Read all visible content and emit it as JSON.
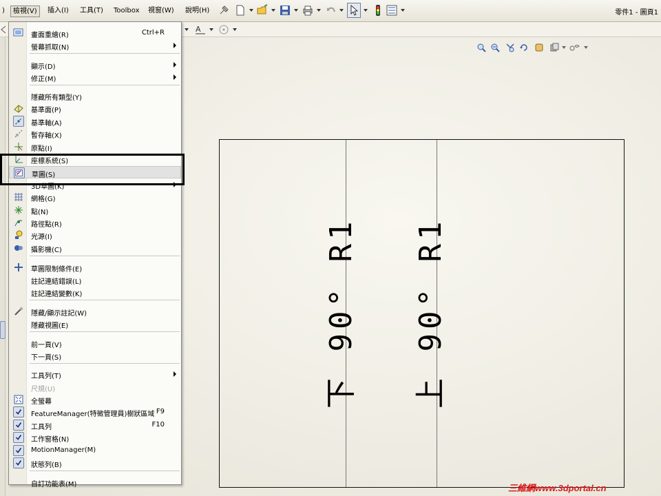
{
  "colors": {
    "accent": "#3b5fa8",
    "watermark": "#d81c1c"
  },
  "menubar": {
    "items": [
      {
        "label": ")"
      },
      {
        "label": "檢視(V)",
        "active": true
      },
      {
        "label": "插入(I)"
      },
      {
        "label": "工具(T)"
      },
      {
        "label": "Toolbox"
      },
      {
        "label": "視窗(W)"
      },
      {
        "label": "說明(H)"
      }
    ],
    "doc_title": "零件1 - 圖頁1"
  },
  "view_menu": {
    "items": [
      {
        "label": "畫面重繪(R)",
        "shortcut": "Ctrl+R",
        "icon": "redraw-icon"
      },
      {
        "label": "螢幕抓取(N)",
        "submenu": true
      },
      {
        "separator": true
      },
      {
        "label": "顯示(D)",
        "submenu": true
      },
      {
        "label": "修正(M)",
        "submenu": true
      },
      {
        "separator": true
      },
      {
        "label": "隱藏所有類型(Y)"
      },
      {
        "label": "基準面(P)",
        "icon": "plane-icon"
      },
      {
        "label": "基準軸(A)",
        "icon": "axis-icon",
        "checked": true
      },
      {
        "label": "暫存軸(X)",
        "icon": "temp-axis-icon"
      },
      {
        "label": "原點(I)",
        "icon": "origin-icon"
      },
      {
        "label": "座標系統(S)",
        "icon": "coordinate-system-icon"
      },
      {
        "label": "草圖(S)",
        "icon": "sketch-icon",
        "checked": true,
        "highlighted": true
      },
      {
        "label": "3D草圖(K)",
        "submenu": true
      },
      {
        "label": "網格(G)",
        "icon": "grid-icon"
      },
      {
        "label": "點(N)",
        "icon": "point-icon"
      },
      {
        "label": "路徑點(R)",
        "icon": "route-point-icon"
      },
      {
        "label": "光源(I)",
        "icon": "light-icon"
      },
      {
        "label": "攝影機(C)",
        "icon": "camera-icon"
      },
      {
        "separator": true
      },
      {
        "label": "草圖限制條件(E)",
        "icon": "sketch-relations-icon"
      },
      {
        "label": "註記連結錯誤(L)"
      },
      {
        "label": "註記連結變數(K)"
      },
      {
        "separator": true
      },
      {
        "label": "隱藏/顯示註記(W)",
        "icon": "annotation-icon"
      },
      {
        "label": "隱藏視圖(E)"
      },
      {
        "separator": true
      },
      {
        "label": "前一頁(V)"
      },
      {
        "label": "下一頁(S)"
      },
      {
        "separator": true
      },
      {
        "label": "工具列(T)",
        "submenu": true
      },
      {
        "label": "尺規(U)",
        "disabled": true
      },
      {
        "label": "全螢幕",
        "icon": "fullscreen-icon"
      },
      {
        "label": "FeatureManager(特徵管理員)樹狀區域",
        "shortcut": "F9",
        "icon": "check-icon",
        "checked": true
      },
      {
        "label": "工具列",
        "shortcut": "F10",
        "icon": "check-icon",
        "checked": true
      },
      {
        "label": "工作窗格(N)",
        "icon": "check-icon",
        "checked": true
      },
      {
        "label": "MotionManager(M)",
        "icon": "check-icon",
        "checked": true
      },
      {
        "label": "狀態列(B)",
        "icon": "check-icon",
        "checked": true
      },
      {
        "separator": true
      },
      {
        "label": "自訂功能表(M)"
      }
    ]
  },
  "drawing": {
    "label_left": "下 90° R1",
    "label_right": "上 90° R1"
  },
  "watermark": "三維網www.3dportal.cn"
}
